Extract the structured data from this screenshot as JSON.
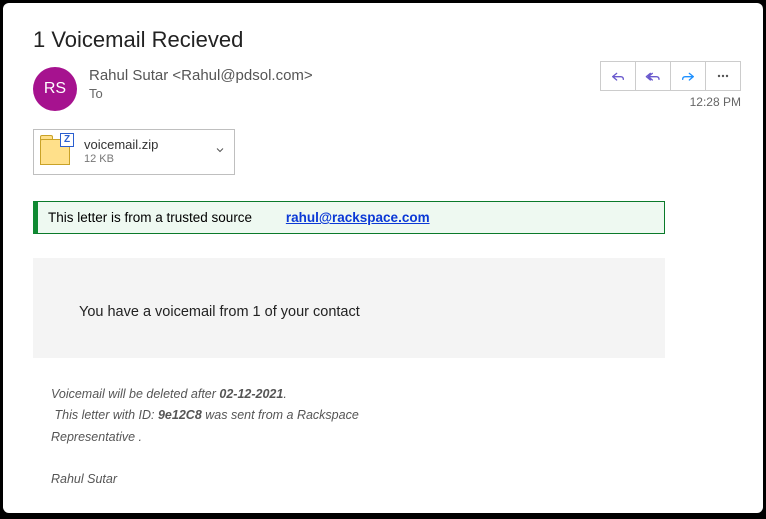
{
  "subject": "1 Voicemail Recieved",
  "avatar_initials": "RS",
  "sender": {
    "display": "Rahul Sutar <Rahul@pdsol.com>",
    "to_label": "To"
  },
  "timestamp": "12:28 PM",
  "attachment": {
    "name": "voicemail.zip",
    "size": "12 KB",
    "zip_badge": "Z"
  },
  "banner": {
    "text": "This letter is from a trusted source",
    "link": "rahul@rackspace.com"
  },
  "body": {
    "main": "You have a voicemail from 1 of your contact"
  },
  "meta": {
    "line1_prefix": "Voicemail will ",
    "line1_italic": "be deleted after ",
    "date": "02-12-2021",
    "line1_suffix": ".",
    "line2_prefix": "This letter with ID: ",
    "id": "9e12C8",
    "line2_suffix": " was sent from a Rackspace",
    "line3": "Representative ."
  },
  "signature": "Rahul Sutar"
}
